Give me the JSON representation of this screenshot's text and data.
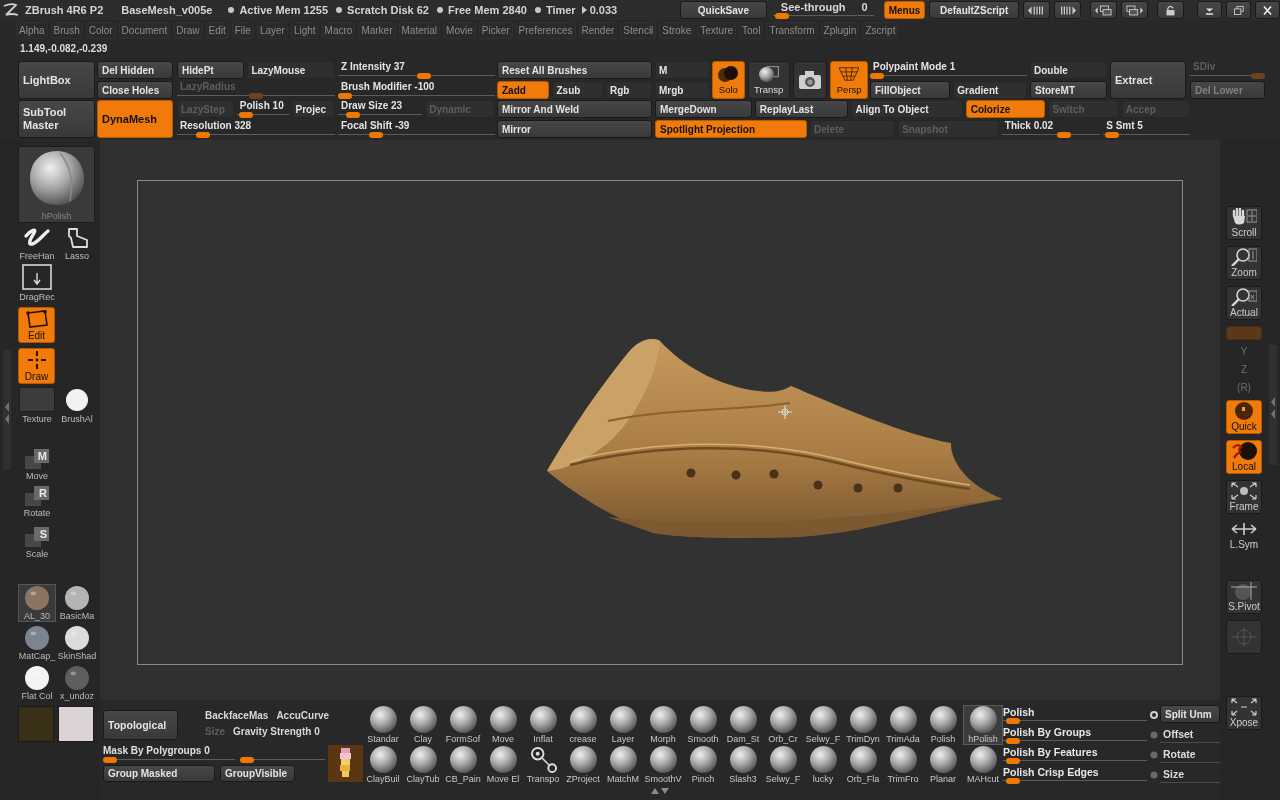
{
  "title_bar": {
    "app_name": "ZBrush 4R6 P2",
    "document": "BaseMesh_v005e",
    "stats": [
      "Active Mem 1255",
      "Scratch Disk 62",
      "Free Mem 2840",
      "Timer"
    ],
    "timer_value": "0.033",
    "quick_save": "QuickSave",
    "see_through": {
      "label": "See-through",
      "value": "0",
      "level": 0.02
    },
    "menus": {
      "label": "Menus",
      "on": true
    },
    "script": "DefaultZScript"
  },
  "menu_bar": [
    "Alpha",
    "Brush",
    "Color",
    "Document",
    "Draw",
    "Edit",
    "File",
    "Layer",
    "Light",
    "Macro",
    "Marker",
    "Material",
    "Movie",
    "Picker",
    "Preferences",
    "Render",
    "Stencil",
    "Stroke",
    "Texture",
    "Tool",
    "Transform",
    "Zplugin",
    "Zscript"
  ],
  "coordinates": "1.149,-0.082,-0.239",
  "top_shelf": {
    "upper": [
      {
        "rows": [
          [
            {
              "kind": "button",
              "label": "LightBox",
              "on": false,
              "disabled": false
            }
          ]
        ]
      },
      {
        "rows": [
          [
            {
              "kind": "button",
              "label": "Del Hidden",
              "on": false,
              "disabled": false
            }
          ],
          [
            {
              "kind": "button",
              "label": "Close Holes",
              "on": false,
              "disabled": false
            }
          ]
        ]
      },
      {
        "rows": [
          [
            {
              "kind": "button",
              "label": "HidePt",
              "on": false,
              "disabled": false
            },
            {
              "kind": "switch",
              "label": "LazyMouse",
              "on": false,
              "disabled": false
            }
          ],
          [
            {
              "kind": "slider",
              "label": "LazyRadius",
              "level": 0.5,
              "on": false,
              "disabled": true
            }
          ]
        ]
      },
      {
        "rows": [
          [
            {
              "kind": "slider",
              "label": "Z Intensity 37",
              "level": 0.55,
              "on": false,
              "disabled": false
            }
          ],
          [
            {
              "kind": "slider",
              "label": "Brush Modifier -100",
              "level": 0,
              "on": false,
              "disabled": false
            }
          ]
        ]
      },
      {
        "rows": [
          [
            {
              "kind": "button",
              "label": "Reset All Brushes",
              "on": false,
              "disabled": false
            }
          ],
          [
            {
              "kind": "button",
              "label": "Zadd",
              "on": true,
              "disabled": false
            },
            {
              "kind": "switch",
              "label": "Zsub",
              "on": false,
              "disabled": false
            },
            {
              "kind": "switch",
              "label": "Rgb",
              "on": false,
              "disabled": false
            }
          ]
        ]
      },
      {
        "rows": [
          [
            {
              "kind": "switch",
              "label": "M",
              "on": false,
              "disabled": false
            }
          ],
          [
            {
              "kind": "switch",
              "label": "Mrgb",
              "on": false,
              "disabled": false
            }
          ]
        ]
      },
      {
        "rows": [
          [
            {
              "kind": "solo",
              "label": "Solo",
              "on": true,
              "disabled": false
            },
            {
              "kind": "transparency",
              "label": "Transp",
              "on": false,
              "disabled": false
            },
            {
              "kind": "camera",
              "on": false,
              "disabled": false
            },
            {
              "kind": "perspective",
              "label": "Persp",
              "on": true,
              "disabled": false
            }
          ]
        ]
      },
      {
        "rows": [
          [
            {
              "kind": "slider",
              "label": "Polypaint Mode 1",
              "level": 0,
              "on": false,
              "disabled": false
            }
          ],
          [
            {
              "kind": "button",
              "label": "FillObject",
              "on": false,
              "disabled": false
            },
            {
              "kind": "switch",
              "label": "Gradient",
              "on": false,
              "disabled": false
            }
          ]
        ]
      },
      {
        "rows": [
          [
            {
              "kind": "switch",
              "label": "Double",
              "on": false,
              "disabled": false
            }
          ],
          [
            {
              "kind": "button",
              "label": "StoreMT",
              "on": false,
              "disabled": false
            }
          ]
        ]
      },
      {
        "rows": [
          [
            {
              "kind": "button",
              "label": "Extract",
              "on": false,
              "disabled": false
            }
          ]
        ]
      },
      {
        "rows": [
          [
            {
              "kind": "slider",
              "label": "SDiv",
              "level": 1,
              "on": false,
              "disabled": true
            }
          ],
          [
            {
              "kind": "button",
              "label": "Del Lower",
              "on": false,
              "disabled": true
            }
          ]
        ]
      }
    ],
    "lower": [
      {
        "rows": [
          [
            {
              "kind": "button",
              "label": "SubTool Master",
              "on": false,
              "disabled": false
            }
          ]
        ]
      },
      {
        "rows": [
          [
            {
              "kind": "button",
              "label": "DynaMesh",
              "on": true,
              "disabled": false
            }
          ]
        ]
      },
      {
        "rows": [
          [
            {
              "kind": "switch",
              "label": "LazyStep",
              "on": false,
              "disabled": true
            },
            {
              "kind": "slider",
              "label": "Polish 10",
              "level": 0.05,
              "on": false,
              "disabled": false
            },
            {
              "kind": "switch",
              "label": "Projec",
              "on": false,
              "disabled": false
            }
          ],
          [
            {
              "kind": "slider",
              "label": "Resolution 328",
              "level": 0.13,
              "on": false,
              "disabled": false
            }
          ]
        ]
      },
      {
        "rows": [
          [
            {
              "kind": "slider",
              "label": "Draw Size 23",
              "level": 0.12,
              "on": false,
              "disabled": false
            },
            {
              "kind": "switch",
              "label": "Dynamic",
              "on": false,
              "disabled": true
            }
          ],
          [
            {
              "kind": "slider",
              "label": "Focal Shift -39",
              "level": 0.22,
              "on": false,
              "disabled": false
            }
          ]
        ]
      },
      {
        "rows": [
          [
            {
              "kind": "button",
              "label": "Mirror And Weld",
              "on": false,
              "disabled": false
            }
          ],
          [
            {
              "kind": "button",
              "label": "Mirror",
              "on": false,
              "disabled": false
            }
          ]
        ]
      },
      {
        "rows": [
          [
            {
              "kind": "button",
              "label": "MergeDown",
              "on": false,
              "disabled": false
            },
            {
              "kind": "button",
              "label": "ReplayLast",
              "on": false,
              "disabled": false
            },
            {
              "kind": "switch",
              "label": "Align To Object",
              "on": false,
              "disabled": false
            },
            {
              "kind": "button",
              "label": "Colorize",
              "on": true,
              "disabled": false
            },
            {
              "kind": "switch",
              "label": "Switch",
              "on": false,
              "disabled": true
            },
            {
              "kind": "switch",
              "label": "Accep",
              "on": false,
              "disabled": true
            }
          ],
          [
            {
              "kind": "button",
              "label": "Spotlight Projection",
              "on": true,
              "disabled": false
            },
            {
              "kind": "switch",
              "label": "Delete",
              "on": false,
              "disabled": true
            },
            {
              "kind": "switch",
              "label": "Snapshot",
              "on": false,
              "disabled": true
            },
            {
              "kind": "slider",
              "label": "Thick 0.02",
              "level": 0.65,
              "on": false,
              "disabled": false
            },
            {
              "kind": "slider",
              "label": "S Smt 5",
              "level": 0.03,
              "on": false,
              "disabled": false
            }
          ]
        ]
      }
    ]
  },
  "left_shelf": {
    "brush": {
      "label": "hPolish"
    },
    "stroke_tools": [
      {
        "kind": "freehand",
        "label": "FreeHan"
      },
      {
        "kind": "lasso",
        "label": "Lasso"
      }
    ],
    "drag": {
      "label": "DragRec"
    },
    "modes": [
      {
        "kind": "edit",
        "label": "Edit",
        "on": true
      },
      {
        "kind": "draw",
        "label": "Draw",
        "on": true
      }
    ],
    "texture": {
      "label": "Texture"
    },
    "alpha": {
      "label": "BrushAl"
    },
    "transforms": [
      {
        "key": "M",
        "label": "Move"
      },
      {
        "key": "R",
        "label": "Rotate"
      },
      {
        "key": "S",
        "label": "Scale"
      }
    ],
    "materials": [
      {
        "label": "AL_30",
        "color": "#8c7462",
        "selected": true
      },
      {
        "label": "BasicMa",
        "color": "#b4b4b4",
        "selected": false
      },
      {
        "label": "MatCap_",
        "color": "#7c8490",
        "selected": false
      },
      {
        "label": "SkinShad",
        "color": "#dcdcdc",
        "selected": false
      },
      {
        "label": "Flat Col",
        "color": "#f4f4f4",
        "selected": false
      },
      {
        "label": "x_undoz",
        "color": "#5e5e5e",
        "selected": false
      }
    ],
    "colors": [
      {
        "color": "#3a3018"
      },
      {
        "color": "#dcd4d4"
      }
    ]
  },
  "right_shelf": {
    "buttons": [
      {
        "kind": "scroll",
        "label": "Scroll",
        "on": false,
        "disabled": false
      },
      {
        "kind": "zoom",
        "label": "Zoom",
        "on": false,
        "disabled": false
      },
      {
        "kind": "actual",
        "label": "Actual",
        "on": false,
        "disabled": false
      },
      {
        "kind": "bar",
        "on": true,
        "disabled": true
      },
      {
        "kind": "text",
        "label": "Y",
        "on": false,
        "disabled": true
      },
      {
        "kind": "text",
        "label": "Z",
        "on": false,
        "disabled": true
      },
      {
        "kind": "text",
        "label": "(R)",
        "on": false,
        "disabled": true
      },
      {
        "kind": "quick",
        "label": "Quick",
        "on": true,
        "disabled": false
      },
      {
        "kind": "local",
        "label": "Local",
        "on": true,
        "disabled": false
      },
      {
        "kind": "frame",
        "label": "Frame",
        "on": false,
        "disabled": false
      },
      {
        "kind": "lsym",
        "label": "L.Sym",
        "on": false,
        "disabled": false
      },
      {
        "kind": "spivot",
        "label": "S.Pivot",
        "on": false,
        "disabled": false
      },
      {
        "kind": "pivot",
        "on": false,
        "disabled": true
      }
    ],
    "xpose": {
      "kind": "xpose",
      "label": "Xpose",
      "on": false,
      "disabled": false
    }
  },
  "bottom_shelf": {
    "topological": {
      "label": "Topological",
      "on": false
    },
    "backface": "BackfaceMas",
    "accucurve": "AccuCurve",
    "size": {
      "label": "Size",
      "disabled": true
    },
    "gravity": {
      "label": "Gravity Strength 0",
      "level": 0
    },
    "mask": {
      "label": "Mask By Polygroups 0",
      "level": 0
    },
    "group_buttons": [
      "Group Masked",
      "GroupVisible"
    ],
    "brush_rows": [
      [
        {
          "label": "Standar",
          "kind": "sphere",
          "selected": false
        },
        {
          "label": "Clay",
          "kind": "sphere",
          "selected": false
        },
        {
          "label": "FormSof",
          "kind": "sphere",
          "selected": false
        },
        {
          "label": "Move",
          "kind": "sphere",
          "selected": false
        },
        {
          "label": "Inflat",
          "kind": "sphere",
          "selected": false
        },
        {
          "label": "crease",
          "kind": "sphere",
          "selected": false
        },
        {
          "label": "Layer",
          "kind": "sphere",
          "selected": false
        },
        {
          "label": "Morph",
          "kind": "sphere",
          "selected": false
        },
        {
          "label": "Smooth",
          "kind": "sphere",
          "selected": false
        },
        {
          "label": "Dam_St",
          "kind": "sphere",
          "selected": false
        },
        {
          "label": "Orb_Cr",
          "kind": "sphere",
          "selected": false
        },
        {
          "label": "Selwy_F",
          "kind": "sphere",
          "selected": false
        },
        {
          "label": "TrimDyn",
          "kind": "sphere",
          "selected": false
        },
        {
          "label": "TrimAda",
          "kind": "sphere",
          "selected": false
        },
        {
          "label": "Polish",
          "kind": "sphere",
          "selected": false
        },
        {
          "label": "hPolish",
          "kind": "sphere",
          "selected": true
        }
      ],
      [
        {
          "label": "ClayBuil",
          "kind": "sphere",
          "selected": false
        },
        {
          "label": "ClayTub",
          "kind": "sphere",
          "selected": false
        },
        {
          "label": "CB_Pain",
          "kind": "sphere",
          "selected": false
        },
        {
          "label": "Move El",
          "kind": "sphere",
          "selected": false
        },
        {
          "label": "Transpo",
          "kind": "gizmo",
          "selected": false
        },
        {
          "label": "ZProject",
          "kind": "sphere",
          "selected": false
        },
        {
          "label": "MatchM",
          "kind": "sphere",
          "selected": false
        },
        {
          "label": "SmoothV",
          "kind": "sphere",
          "selected": false
        },
        {
          "label": "Pinch",
          "kind": "sphere",
          "selected": false
        },
        {
          "label": "Slash3",
          "kind": "sphere",
          "selected": false
        },
        {
          "label": "Selwy_F",
          "kind": "sphere",
          "selected": false
        },
        {
          "label": "lucky",
          "kind": "sphere",
          "selected": false
        },
        {
          "label": "Orb_Fla",
          "kind": "sphere",
          "selected": false
        },
        {
          "label": "TrimFro",
          "kind": "sphere",
          "selected": false
        },
        {
          "label": "Planar",
          "kind": "sphere",
          "selected": false
        },
        {
          "label": "MAHcut",
          "kind": "sphere",
          "selected": false
        }
      ]
    ],
    "polish": [
      {
        "label": "Polish",
        "level": 0.02,
        "on": true
      },
      {
        "label": "Polish By Groups",
        "level": 0.02,
        "on": false
      },
      {
        "label": "Polish By Features",
        "level": 0.02,
        "on": false
      },
      {
        "label": "Polish Crisp Edges",
        "level": 0.02,
        "on": false
      }
    ],
    "deform": [
      {
        "kind": "button",
        "label": "Split Unm"
      },
      {
        "kind": "option",
        "label": "Offset"
      },
      {
        "kind": "option",
        "label": "Rotate"
      },
      {
        "kind": "option",
        "label": "Size"
      }
    ]
  }
}
